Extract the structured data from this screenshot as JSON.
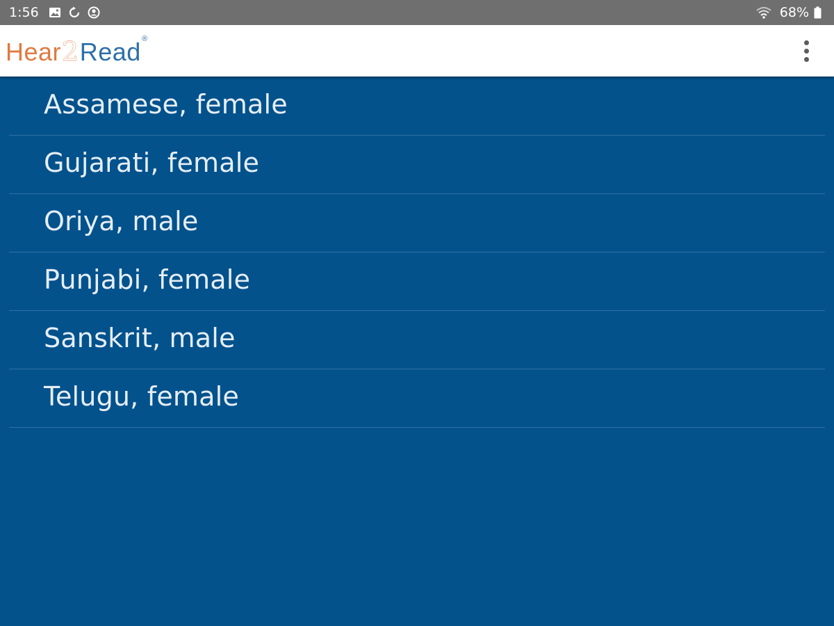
{
  "status_bar": {
    "time": "1:56",
    "battery": "68%",
    "icons": [
      "image-icon",
      "sync-icon",
      "account-circle-icon",
      "wifi-icon",
      "battery-icon"
    ]
  },
  "app_bar": {
    "logo": {
      "part1": "Hear",
      "part2": "2",
      "part3": "Read",
      "registered": "®"
    },
    "menu_icon": "more-vertical-icon"
  },
  "voices": [
    {
      "label": "Assamese, female"
    },
    {
      "label": "Gujarati, female"
    },
    {
      "label": "Oriya, male"
    },
    {
      "label": "Punjabi, female"
    },
    {
      "label": "Sanskrit, male"
    },
    {
      "label": "Telugu, female"
    }
  ],
  "colors": {
    "background": "#03528c",
    "status_bar": "#6f6f6f",
    "app_bar": "#ffffff",
    "logo_orange": "#e07a3f",
    "logo_blue": "#2d6fa8",
    "list_text": "#e6eef6",
    "divider": "#2f70a6"
  }
}
